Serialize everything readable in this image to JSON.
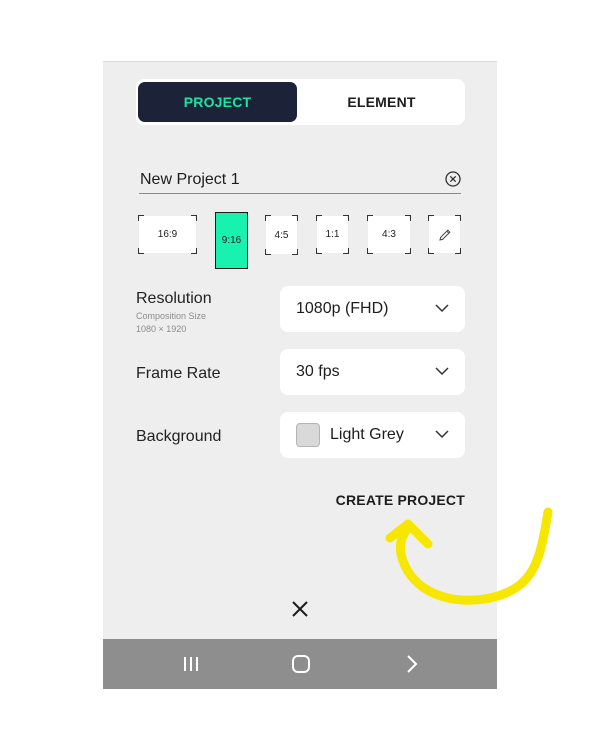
{
  "tabs": [
    {
      "label": "PROJECT",
      "active": true
    },
    {
      "label": "ELEMENT",
      "active": false
    }
  ],
  "project_name": {
    "value": "New Project 1",
    "clear_icon": "clear-circle-icon"
  },
  "aspect_ratios": [
    {
      "label": "16:9",
      "selected": false
    },
    {
      "label": "9:16",
      "selected": true
    },
    {
      "label": "4:5",
      "selected": false
    },
    {
      "label": "1:1",
      "selected": false
    },
    {
      "label": "4:3",
      "selected": false
    },
    {
      "label": "",
      "icon": "pencil-icon",
      "selected": false
    }
  ],
  "resolution": {
    "label": "Resolution",
    "sub_label": "Composition Size",
    "size": "1080 × 1920",
    "value": "1080p (FHD)"
  },
  "frame_rate": {
    "label": "Frame Rate",
    "value": "30 fps"
  },
  "background": {
    "label": "Background",
    "value": "Light Grey",
    "swatch_color": "#d9d9d9"
  },
  "create_label": "CREATE PROJECT",
  "close_icon": "close-x-icon",
  "nav": {
    "icons": [
      "recent-apps-icon",
      "home-icon",
      "back-icon"
    ]
  },
  "colors": {
    "accent": "#19e6a4",
    "tab_active_bg": "#1c2237",
    "annotation": "#f7e600"
  }
}
